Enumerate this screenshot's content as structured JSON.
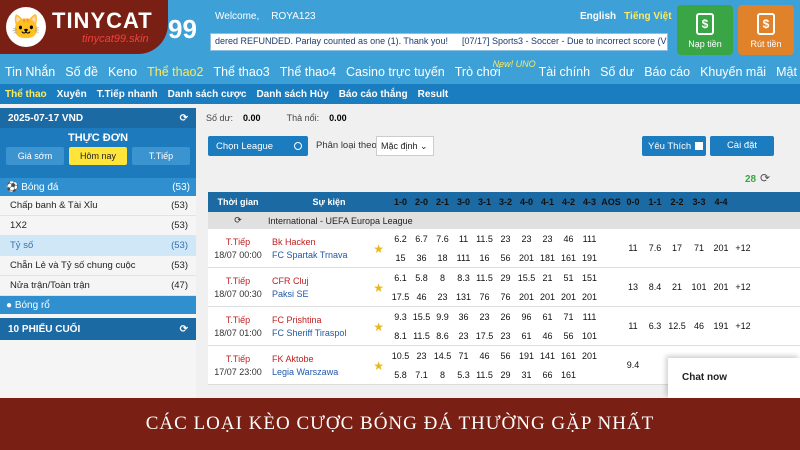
{
  "brand": {
    "logo_text": "TINYCAT",
    "logo_site": "tinycat99.skin",
    "big99": "99"
  },
  "header": {
    "welcome_label": "Welcome,",
    "username": "ROYA123",
    "lang_en": "English",
    "lang_vi": "Tiếng Việt",
    "ticker": [
      "dered REFUNDED. Parlay counted as one (1). Thank you!",
      "[07/17] Sports3 - Soccer - Due to incorrect score (V"
    ],
    "deposit_label": "Nạp tiền",
    "withdraw_label": "Rút tiền"
  },
  "nav": {
    "items": [
      "Tin Nhắn",
      "Số đề",
      "Keno",
      "Thể thao2",
      "Thể thao3",
      "Thể thao4",
      "Casino trực tuyến",
      "Trò chơi",
      "Tài chính",
      "Số dư",
      "Báo cáo",
      "Khuyến mãi",
      "Mật Khẩu"
    ],
    "new_badge": "New! UNO"
  },
  "subnav": {
    "items": [
      "Thể thao",
      "Xuyên",
      "T.Tiếp nhanh",
      "Danh sách cược",
      "Danh sách Hủy",
      "Báo cáo thắng",
      "Result"
    ]
  },
  "sidebar": {
    "date": "2025-07-17 VND",
    "menu_title": "THỰC ĐƠN",
    "tabs": [
      "Giá sớm",
      "Hôm nay",
      "T.Tiếp"
    ],
    "sport_football": "Bóng đá",
    "football_count": "(53)",
    "rows": [
      {
        "label": "Chấp banh & Tài Xỉu",
        "count": "(53)"
      },
      {
        "label": "1X2",
        "count": "(53)"
      },
      {
        "label": "Tỷ số",
        "count": "(53)"
      },
      {
        "label": "Chẵn Lẻ và Tỷ số chung cuộc",
        "count": "(53)"
      },
      {
        "label": "Nửa trận/Toàn trận",
        "count": "(47)"
      }
    ],
    "sport_basket": "Bóng rổ",
    "last10": "10 PHIẾU CUỐI"
  },
  "main": {
    "balance_label": "Số dư:",
    "balance": "0.00",
    "outstanding_label": "Thả nổi:",
    "outstanding": "0.00",
    "choose_league": "Chọn League",
    "filter_label": "Phân loại theo",
    "filter_value": "Mặc định",
    "favorites": "Yêu Thích",
    "settings": "Cài đặt",
    "match_count": "28"
  },
  "table": {
    "headers": [
      "Thời gian",
      "Sự kiện",
      "1-0",
      "2-0",
      "2-1",
      "3-0",
      "3-1",
      "3-2",
      "4-0",
      "4-1",
      "4-2",
      "4-3",
      "AOS",
      "0-0",
      "1-1",
      "2-2",
      "3-3",
      "4-4"
    ],
    "league": "International - UEFA Europa League",
    "matches": [
      {
        "status": "T.Tiếp",
        "time": "18/07 00:00",
        "home": "Bk Hacken",
        "away": "FC Spartak Trnava",
        "r1": [
          "6.2",
          "6.7",
          "7.6",
          "11",
          "11.5",
          "23",
          "23",
          "23",
          "46",
          "111"
        ],
        "r2": [
          "15",
          "36",
          "18",
          "111",
          "16",
          "56",
          "201",
          "181",
          "161",
          "191"
        ],
        "d": [
          "11",
          "7.6",
          "17",
          "71",
          "201",
          "+12"
        ]
      },
      {
        "status": "T.Tiếp",
        "time": "18/07 00:30",
        "home": "CFR Cluj",
        "away": "Paksi SE",
        "r1": [
          "6.1",
          "5.8",
          "8",
          "8.3",
          "11.5",
          "29",
          "15.5",
          "21",
          "51",
          "151"
        ],
        "r2": [
          "17.5",
          "46",
          "23",
          "131",
          "76",
          "76",
          "201",
          "201",
          "201",
          "201"
        ],
        "d": [
          "13",
          "8.4",
          "21",
          "101",
          "201",
          "+12"
        ]
      },
      {
        "status": "T.Tiếp",
        "time": "18/07 01:00",
        "home": "FC Prishtina",
        "away": "FC Sheriff Tiraspol",
        "r1": [
          "9.3",
          "15.5",
          "9.9",
          "36",
          "23",
          "26",
          "96",
          "61",
          "71",
          "111"
        ],
        "r2": [
          "8.1",
          "11.5",
          "8.6",
          "23",
          "17.5",
          "23",
          "61",
          "46",
          "56",
          "101"
        ],
        "d": [
          "11",
          "6.3",
          "12.5",
          "46",
          "191",
          "+12"
        ]
      },
      {
        "status": "T.Tiếp",
        "time": "17/07 23:00",
        "home": "FK Aktobe",
        "away": "Legia Warszawa",
        "r1": [
          "10.5",
          "23",
          "14.5",
          "71",
          "46",
          "56",
          "191",
          "141",
          "161",
          "201"
        ],
        "r2": [
          "5.8",
          "7.1",
          "8",
          "5.3",
          "11.5",
          "29",
          "31",
          "66",
          "161",
          ""
        ],
        "d": [
          "9.4",
          "",
          "",
          "",
          "",
          ""
        ]
      }
    ]
  },
  "chat_label": "Chat now",
  "banner": "CÁC LOẠI KÈO CƯỢC BÓNG ĐÁ THƯỜNG GẶP NHẤT"
}
